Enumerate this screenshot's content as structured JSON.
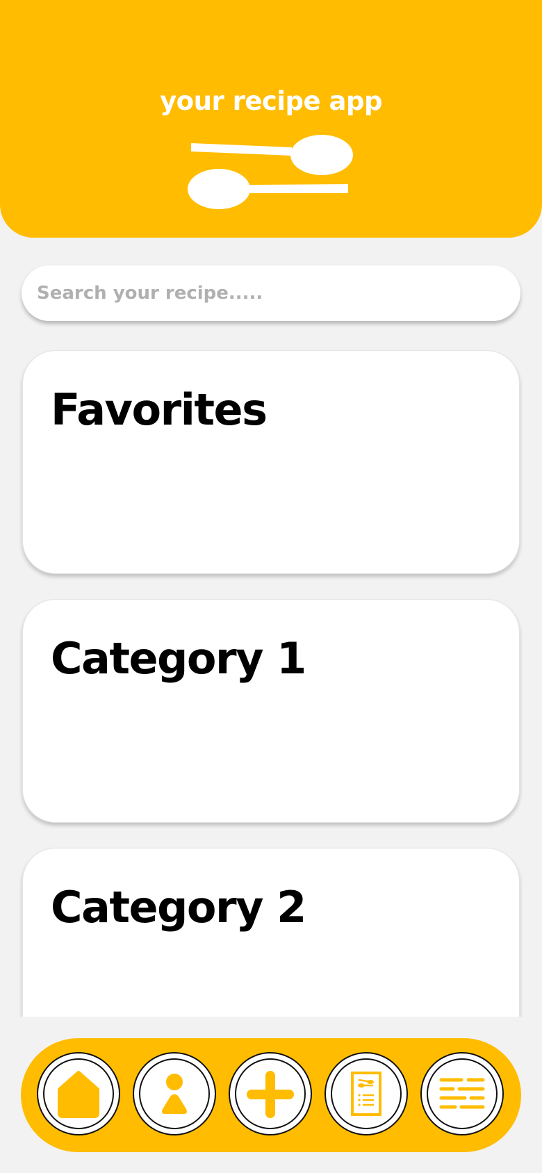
{
  "header": {
    "title": "your recipe app",
    "logo_icon": "crossed-spoons-icon",
    "background_color": "#ffbc00"
  },
  "search": {
    "placeholder": "Search your recipe.....",
    "value": ""
  },
  "cards": [
    {
      "title": "Favorites"
    },
    {
      "title": "Category 1"
    },
    {
      "title": "Category 2"
    }
  ],
  "bottom_nav": {
    "accent_color": "#ffbc00",
    "items": [
      {
        "icon": "home-icon"
      },
      {
        "icon": "profile-icon"
      },
      {
        "icon": "add-icon"
      },
      {
        "icon": "recipe-book-icon"
      },
      {
        "icon": "menu-list-icon"
      }
    ]
  }
}
